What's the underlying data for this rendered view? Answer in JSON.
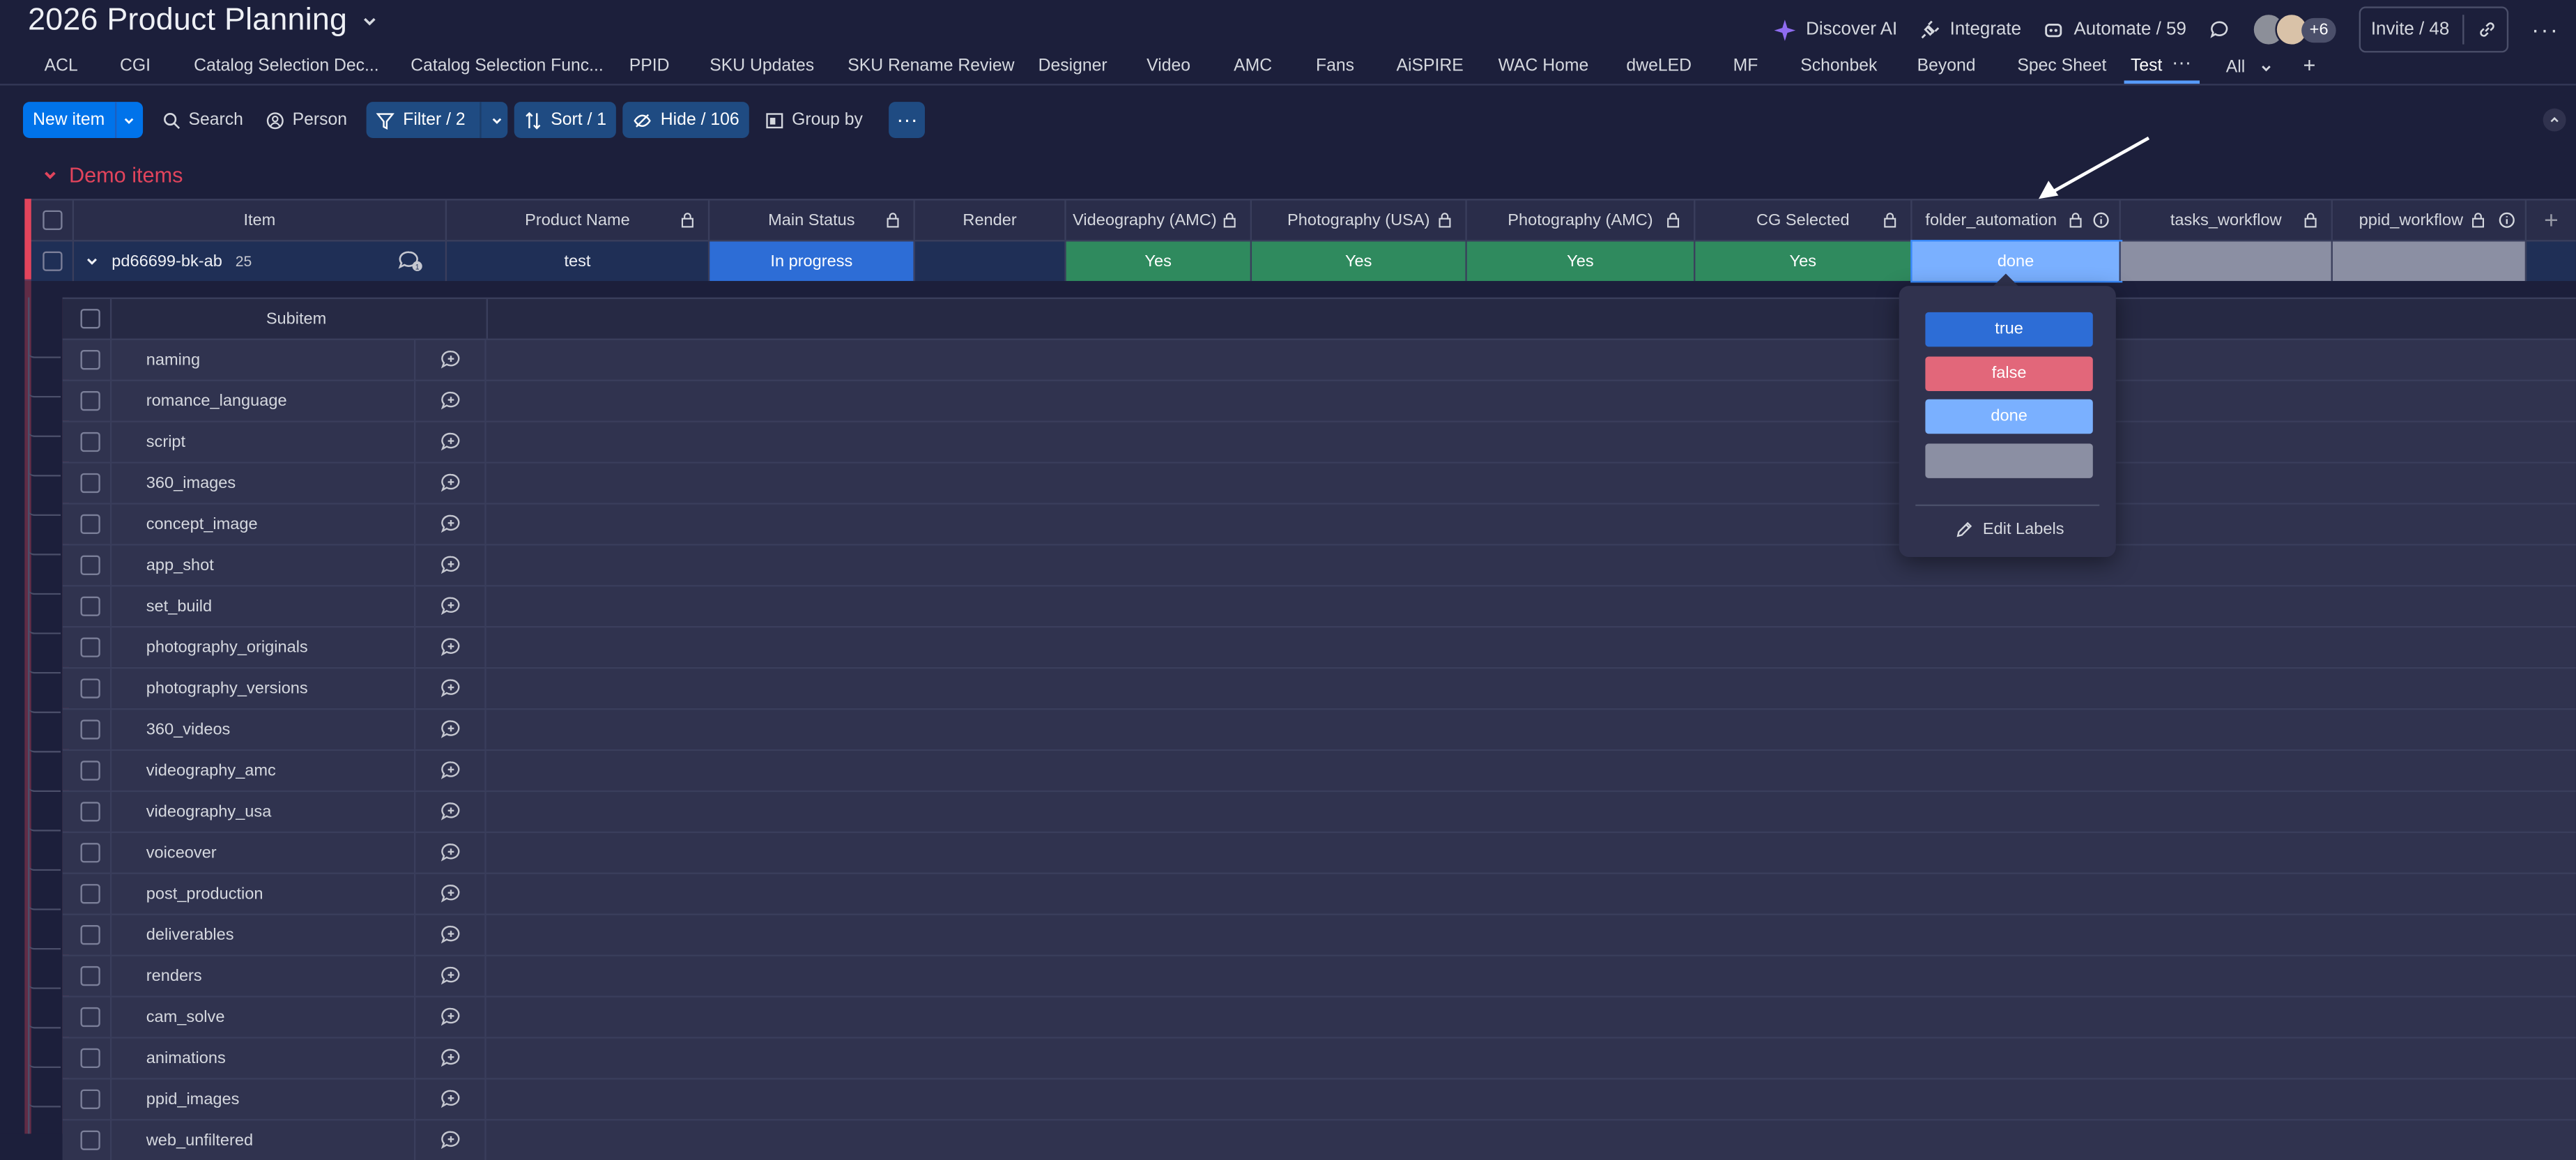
{
  "board": {
    "title": "2026 Product Planning"
  },
  "topbar": {
    "discover_ai": "Discover AI",
    "integrate": "Integrate",
    "automate": "Automate / 59",
    "avatars_more": "+6",
    "invite": "Invite / 48"
  },
  "tabs": [
    "ACL",
    "CGI",
    "Catalog Selection Dec...",
    "Catalog Selection Func...",
    "PPID",
    "SKU Updates",
    "SKU Rename Review",
    "Designer",
    "Video",
    "AMC",
    "Fans",
    "AiSPIRE",
    "WAC Home",
    "dweLED",
    "MF",
    "Schonbek",
    "Beyond",
    "Spec Sheet",
    "Test"
  ],
  "tabs_extra": {
    "all": "All",
    "add": "+"
  },
  "toolbar": {
    "new_item": "New item",
    "search": "Search",
    "person": "Person",
    "filter": "Filter / 2",
    "sort": "Sort / 1",
    "hide": "Hide / 106",
    "group_by": "Group by"
  },
  "group": {
    "title": "Demo items",
    "color": "#e2445c"
  },
  "columns": [
    "Item",
    "Product Name",
    "Main Status",
    "Render",
    "Videography (AMC)",
    "Photography (USA)",
    "Photography (AMC)",
    "CG Selected",
    "folder_automation",
    "tasks_workflow",
    "ppid_workflow"
  ],
  "item": {
    "name": "pd66699-bk-ab",
    "count": "25",
    "product_name": "test",
    "main_status": "In progress",
    "render": "",
    "videography_amc": "Yes",
    "photography_usa": "Yes",
    "photography_amc": "Yes",
    "cg_selected": "Yes",
    "folder_automation": "done",
    "tasks_workflow": "",
    "ppid_workflow": ""
  },
  "subitems": {
    "header": "Subitem",
    "rows": [
      "naming",
      "romance_language",
      "script",
      "360_images",
      "concept_image",
      "app_shot",
      "set_build",
      "photography_originals",
      "photography_versions",
      "360_videos",
      "videography_amc",
      "videography_usa",
      "voiceover",
      "post_production",
      "deliverables",
      "renders",
      "cam_solve",
      "animations",
      "ppid_images",
      "web_unfiltered"
    ]
  },
  "dropdown": {
    "options": [
      {
        "label": "true",
        "color": "#2d6dd6"
      },
      {
        "label": "false",
        "color": "#e2677a"
      },
      {
        "label": "done",
        "color": "#7ab0ff"
      },
      {
        "label": "",
        "color": "#8b8fa3"
      }
    ],
    "edit_labels": "Edit Labels"
  },
  "colors": {
    "background": "#1c1f3b",
    "accent": "#0073ea",
    "status_green": "#2f8a5e"
  }
}
